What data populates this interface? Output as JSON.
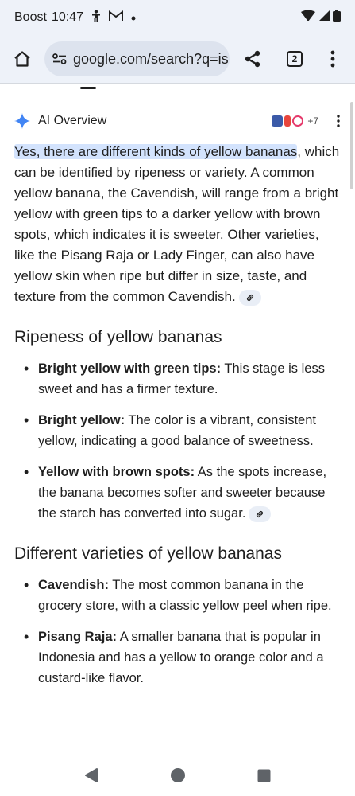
{
  "status_bar": {
    "carrier": "Boost",
    "time": "10:47"
  },
  "toolbar": {
    "url": "google.com/search?q=is",
    "tab_count": "2"
  },
  "ai_overview": {
    "title": "AI Overview",
    "more_sources": "+7",
    "intro_highlight": "Yes, there are different kinds of yellow bananas",
    "intro_rest": ", which can be identified by ripeness or variety. A common yellow banana, the Cavendish, will range from a bright yellow with green tips to a darker yellow with brown spots, which indicates it is sweeter. Other varieties, like the Pisang Raja or Lady Finger, can also have yellow skin when ripe but differ in size, taste, and texture from the common Cavendish."
  },
  "sections": [
    {
      "heading": "Ripeness of yellow bananas",
      "items": [
        {
          "term": "Bright yellow with green tips:",
          "text": " This stage is less sweet and has a firmer texture."
        },
        {
          "term": "Bright yellow:",
          "text": " The color is a vibrant, consistent yellow, indicating a good balance of sweetness."
        },
        {
          "term": "Yellow with brown spots:",
          "text": " As the spots increase, the banana becomes softer and sweeter because the starch has converted into sugar."
        }
      ]
    },
    {
      "heading": "Different varieties of yellow bananas",
      "items": [
        {
          "term": "Cavendish:",
          "text": " The most common banana in the grocery store, with a classic yellow peel when ripe."
        },
        {
          "term": "Pisang Raja:",
          "text": " A smaller banana that is popular in Indonesia and has a yellow to orange color and a custard-like flavor."
        }
      ]
    }
  ],
  "colors": {
    "chrome_bg": "#eef2f9",
    "highlight": "#d3e3fd",
    "accent": "#4285f4"
  }
}
